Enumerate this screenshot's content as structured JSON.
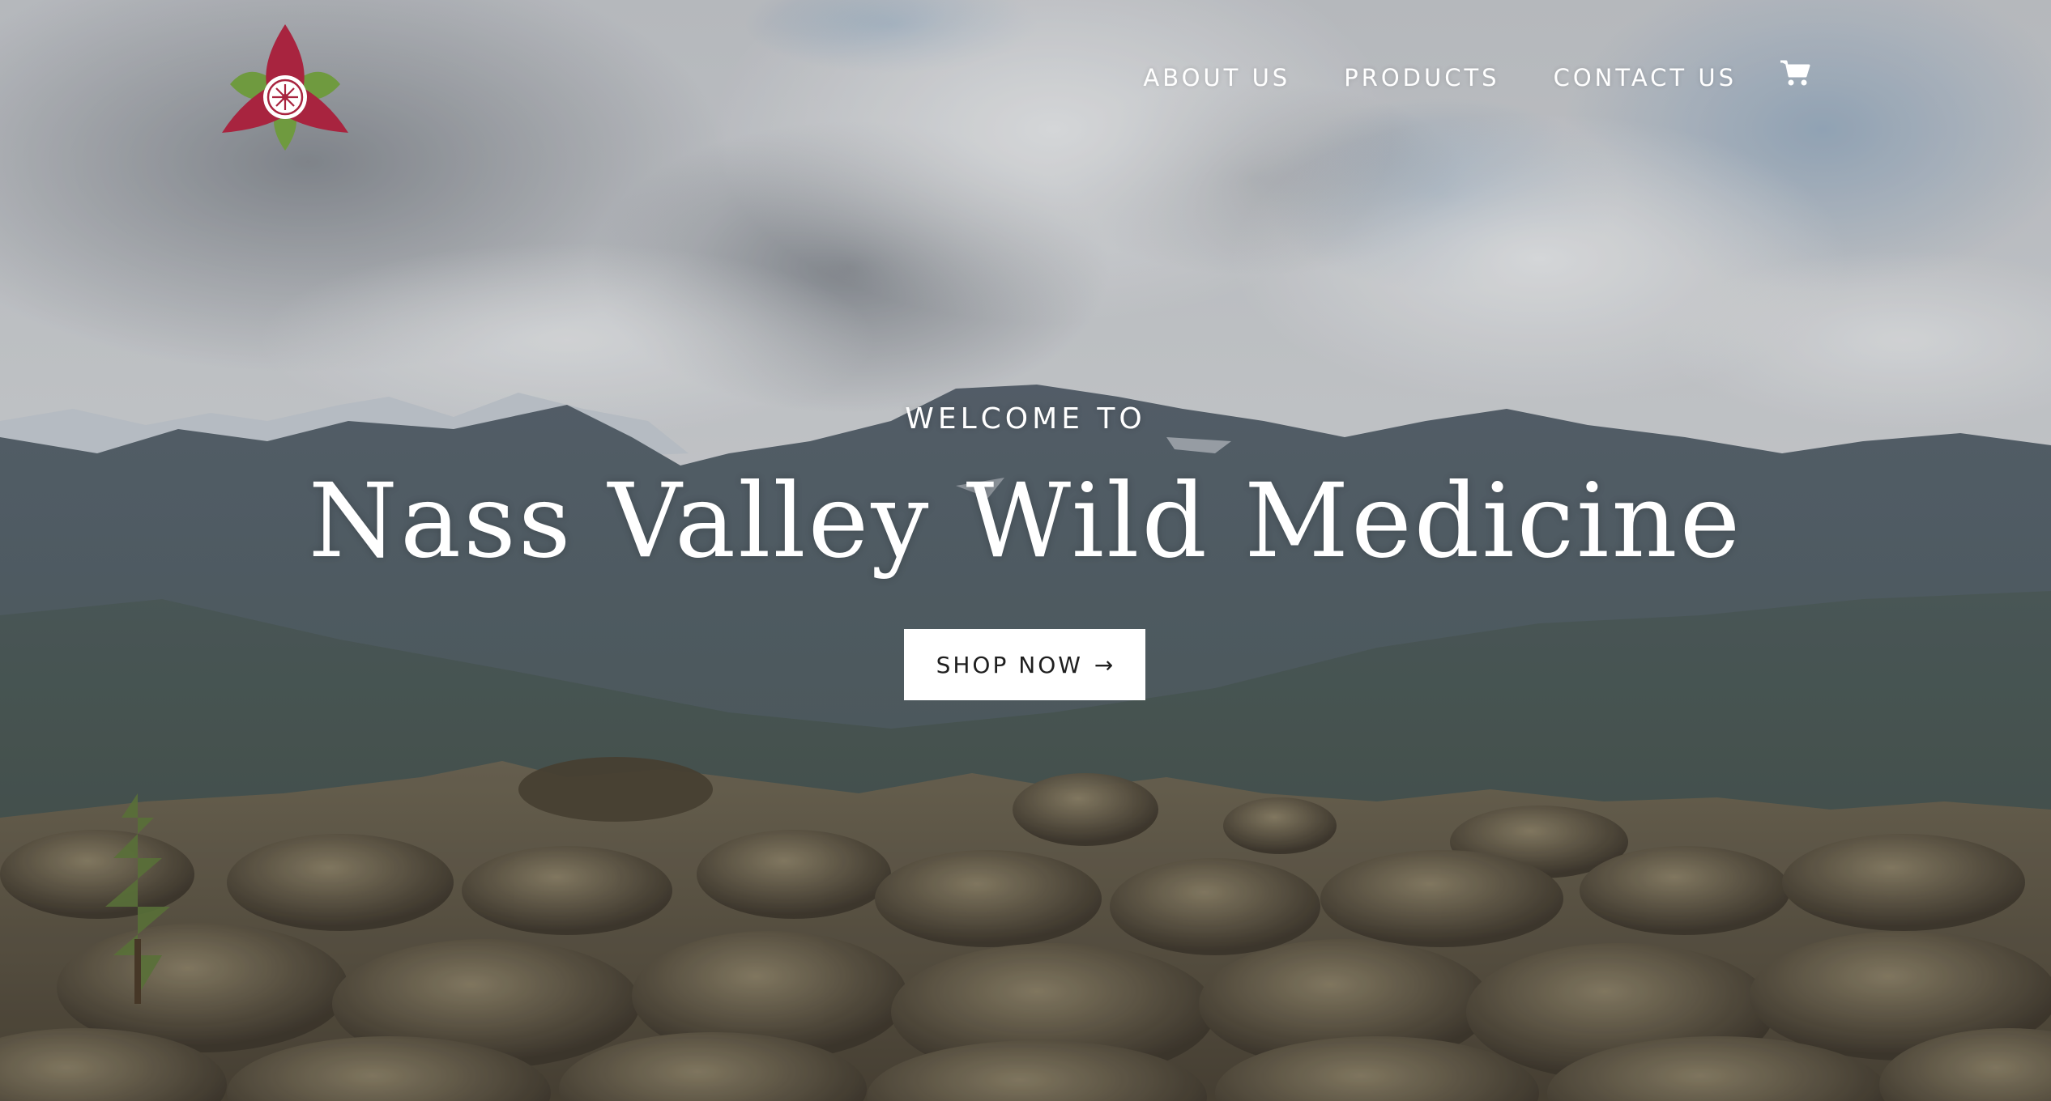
{
  "header": {
    "logo_name": "trillium-logo",
    "nav": {
      "about": "ABOUT US",
      "products": "PRODUCTS",
      "contact": "CONTACT US"
    },
    "cart_icon": "cart-icon"
  },
  "hero": {
    "welcome": "WELCOME TO",
    "title": "Nass Valley Wild Medicine",
    "cta_label": "SHOP NOW",
    "cta_arrow": "→"
  },
  "colors": {
    "logo_petal": "#a8243f",
    "logo_leaf": "#6f9a3f",
    "button_bg": "#ffffff",
    "text_light": "#ffffff"
  }
}
